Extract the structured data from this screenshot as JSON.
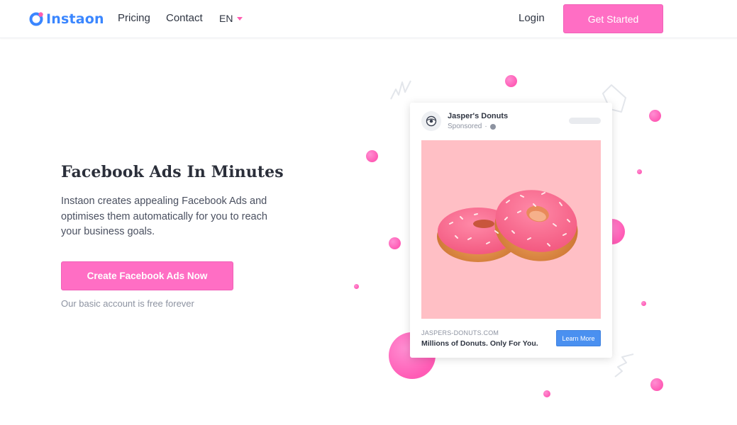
{
  "nav": {
    "brand": "Instaon",
    "links": [
      "Pricing",
      "Contact"
    ],
    "language": "EN",
    "login": "Login",
    "cta": "Get Started"
  },
  "hero": {
    "title": "Facebook Ads In Minutes",
    "description": "Instaon creates appealing Facebook Ads and optimises them automatically for you to reach your business goals.",
    "cta": "Create Facebook Ads Now",
    "note": "Our basic account is free forever"
  },
  "ad": {
    "page_name": "Jasper's Donuts",
    "sponsored": "Sponsored",
    "domain": "JASPERS-DONUTS.COM",
    "headline": "Millions of Donuts. Only For You.",
    "button": "Learn More"
  },
  "colors": {
    "brand_blue": "#3a86ff",
    "accent_pink": "#ff6ec4",
    "ad_background": "#ffbfc5",
    "learn_more_blue": "#4a90f0"
  },
  "icons": [
    "logo-icon",
    "language-caret-icon",
    "donut-avatar-icon",
    "globe-icon",
    "donuts-image"
  ]
}
